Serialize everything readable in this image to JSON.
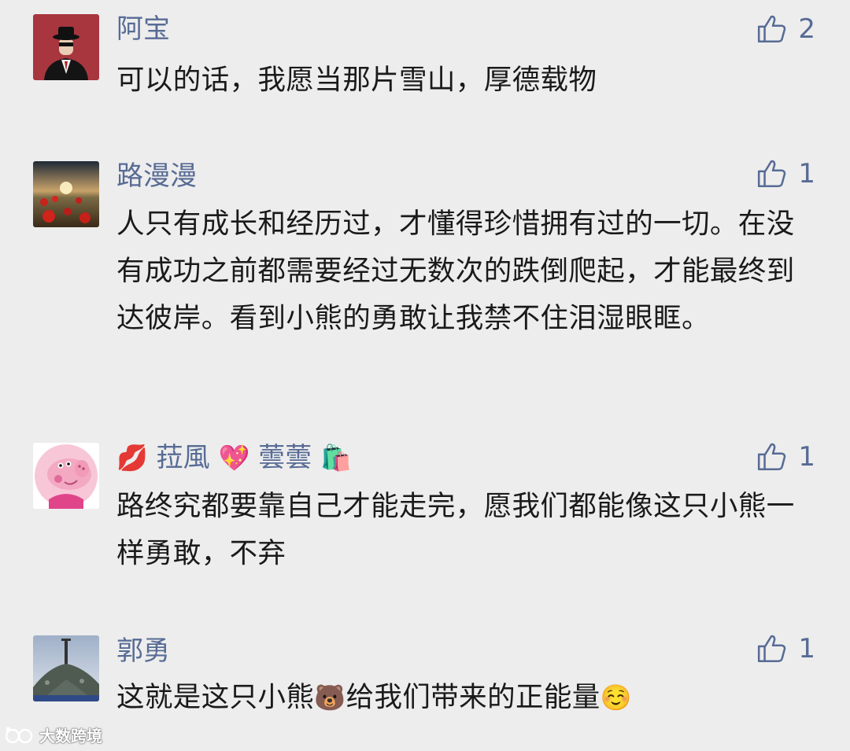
{
  "comments": [
    {
      "name": "阿宝",
      "text": "可以的话，我愿当那片雪山，厚德载物",
      "likes": "2",
      "avatar_icon": "man-in-hat-avatar-icon"
    },
    {
      "name": "路漫漫",
      "text": "人只有成长和经历过，才懂得珍惜拥有过的一切。在没有成功之前都需要经过无数次的跌倒爬起，才能最终到达彼岸。看到小熊的勇敢让我禁不住泪湿眼眶。",
      "likes": "1",
      "avatar_icon": "poppy-field-sunset-avatar-icon"
    },
    {
      "name_parts": [
        "💋",
        "菈風",
        "💖",
        "蕓蕓",
        "🛍️"
      ],
      "text": "路终究都要靠自己才能走完，愿我们都能像这只小熊一样勇敢，不弃",
      "likes": "1",
      "avatar_icon": "peppa-pig-avatar-icon"
    },
    {
      "name": "郭勇",
      "text_parts": [
        "这就是这只小熊",
        "🐻",
        "给我们带来的正能量",
        "☺️"
      ],
      "likes": "1",
      "avatar_icon": "tower-hill-avatar-icon"
    }
  ],
  "watermark": {
    "text": "大数跨境",
    "icon": "logo-icon"
  },
  "colors": {
    "background": "#ededed",
    "name": "#576b95",
    "text": "#1a1a1a"
  }
}
